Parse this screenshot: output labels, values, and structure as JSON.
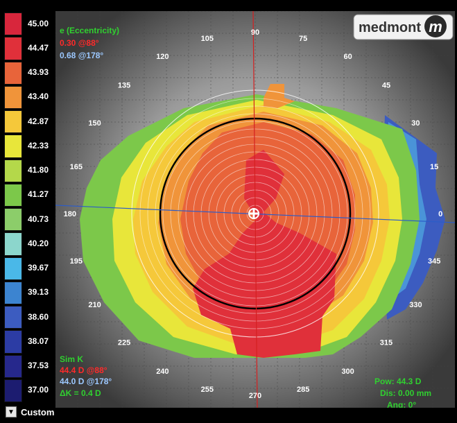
{
  "legend": {
    "values": [
      "45.00",
      "44.47",
      "43.93",
      "43.40",
      "42.87",
      "42.33",
      "41.80",
      "41.27",
      "40.73",
      "40.20",
      "39.67",
      "39.13",
      "38.60",
      "38.07",
      "37.53",
      "37.00"
    ],
    "colors": [
      "#d8263c",
      "#e0303a",
      "#e8643a",
      "#f0943a",
      "#f5c83a",
      "#e8e63a",
      "#b4d84a",
      "#7cc84a",
      "#8ccd6a",
      "#8cd6cc",
      "#4ab8e8",
      "#3c84d0",
      "#3c5cc0",
      "#2c3ca4",
      "#26288c",
      "#1c1c70"
    ]
  },
  "dropdown": {
    "label": "Custom"
  },
  "overlay": {
    "eccentricity_title": "e (Eccentricity)",
    "ecc_line1": "0.30 @88°",
    "ecc_line2": "0.68 @178°",
    "simk_title": "Sim K",
    "simk_line1": "44.4 D @88°",
    "simk_line2": "44.0 D @178°",
    "delta_k": "ΔK = 0.4 D",
    "pow": "Pow: 44.3 D",
    "dis": "Dis: 0.00 mm",
    "ang": "Ang: 0°",
    "logo": "medmont",
    "logo_mark": "m"
  },
  "angles": [
    "0",
    "15",
    "30",
    "45",
    "60",
    "75",
    "90",
    "105",
    "120",
    "135",
    "150",
    "165",
    "180",
    "195",
    "210",
    "225",
    "240",
    "255",
    "270",
    "285",
    "300",
    "315",
    "330",
    "345"
  ],
  "palette": {
    "red": "#e0303a",
    "orange_red": "#e8643a",
    "orange": "#f0943a",
    "yellow": "#f5c83a",
    "green": "#7cc84a",
    "blue": "#3c5cc0",
    "axis_red": "#d42020",
    "axis_blue": "#2c5cc8",
    "text_green": "#30d030",
    "text_red": "#ff2a2a",
    "text_blue": "#9cc8ff"
  }
}
